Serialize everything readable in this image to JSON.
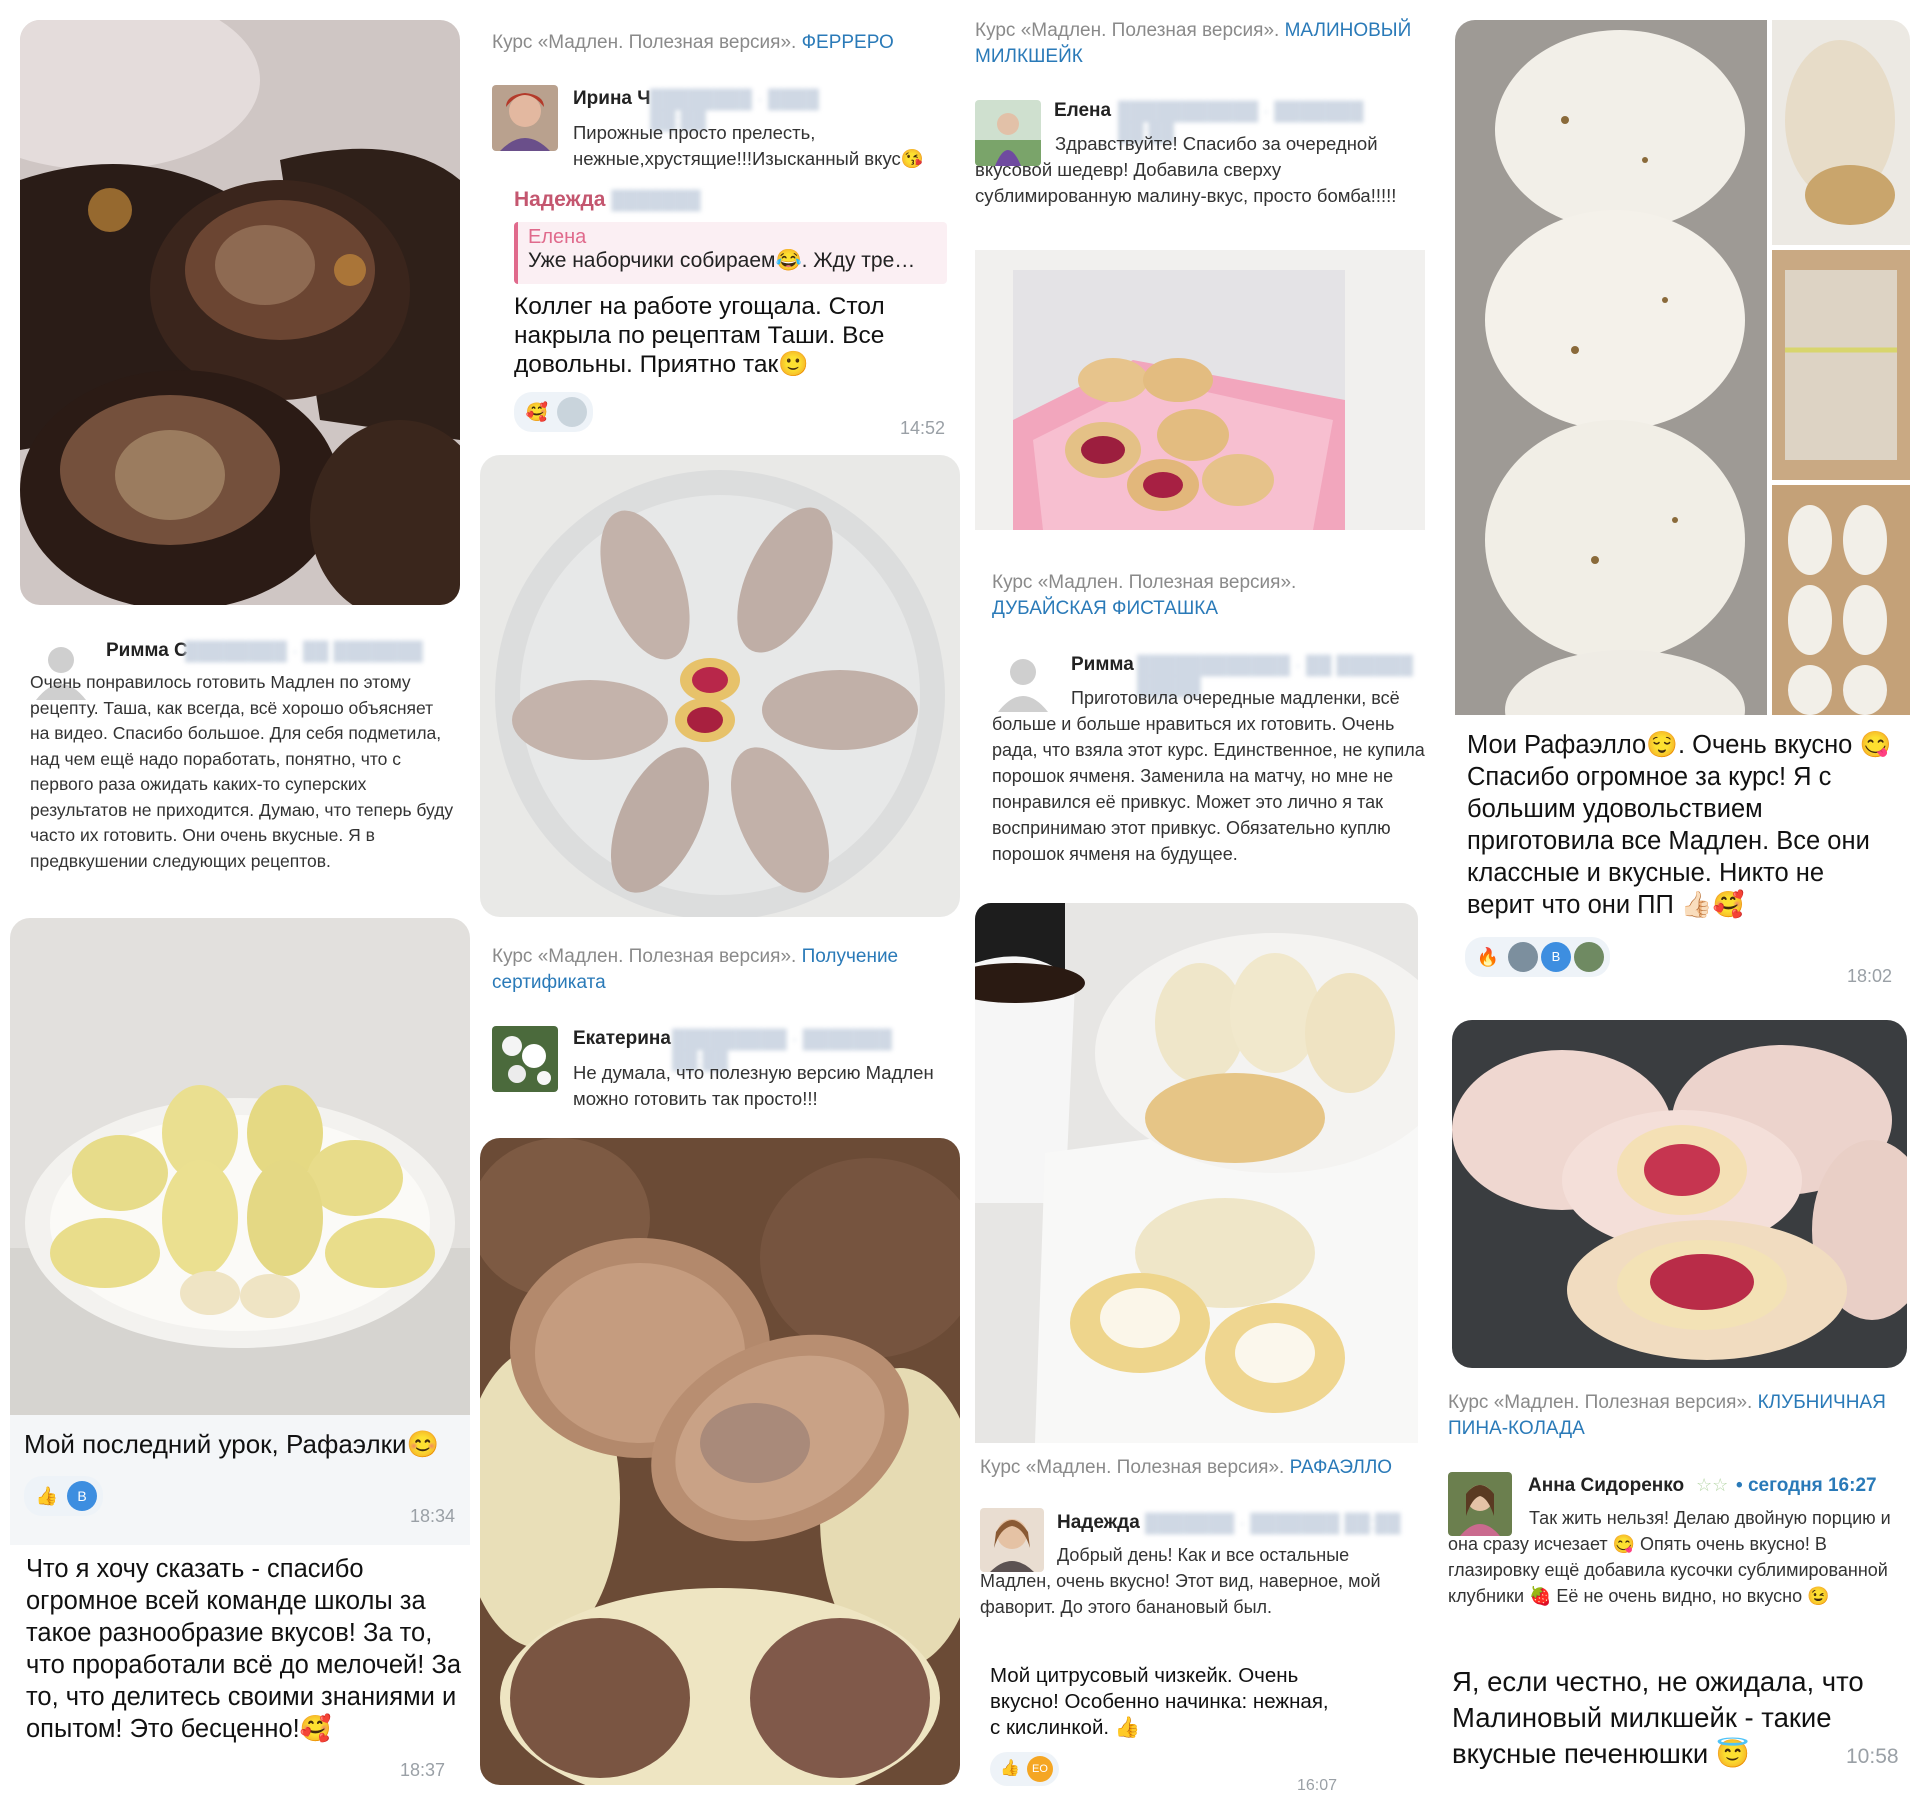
{
  "course_prefix": "Курс «Мадлен. Полезная версия».",
  "reviews": {
    "rimma_s": {
      "author": "Римма С",
      "text": "Очень понравилось готовить Мадлен по этому рецепту. Таша, как всегда, всё хорошо объясняет на видео. Спасибо большое. Для себя подметила, над чем ещё надо поработать, понятно, что с первого раза ожидать каких-то суперских результатов не приходится. Думаю, что теперь буду часто их готовить. Они очень вкусные. Я в предвкушении следующих рецептов."
    },
    "irina": {
      "course_link": "ФЕРРЕРО",
      "author": "Ирина Ч",
      "text": "Пирожные просто прелесть, нежные,хрустящие!!!Изысканный вкус😘"
    },
    "nadezhda_chat": {
      "author": "Надежда",
      "quote_author": "Елена",
      "quote_text": "Уже наборчики собираем😂. Жду тре…",
      "text": "Коллег на работе угощала. Стол накрыла по рецептам Таши. Все довольны. Приятно так🙂",
      "reaction": "🥰",
      "time": "14:52"
    },
    "elena": {
      "course_link": "МАЛИНОВЫЙ МИЛКШЕЙК",
      "author": "Елена",
      "text": "Здравствуйте! Спасибо за очередной вкусовой шедевр! Добавила сверху сублимированную малину-вкус, просто бомба!!!!!"
    },
    "rimma": {
      "course_link": "ДУБАЙСКАЯ ФИСТАШКА",
      "author": "Римма",
      "text": "Приготовила очередные мадленки, всё больше и больше нравиться их готовить. Очень рада, что взяла этот курс. Единственное, не купила порошок ячменя. Заменила на матчу, но мне не понравился её привкус. Может это лично я так воспринимаю этот привкус. Обязательно куплю порошок ячменя на будущее."
    },
    "raffaello_chat": {
      "text": "Мои Рафаэлло😌. Очень вкусно 😋Спасибо огромное за курс! Я с большим удовольствием приготовила все Мадлен. Все они классные и вкусные. Никто не верит что они ПП 👍🏻🥰",
      "reaction": "🔥",
      "badge": "В",
      "time": "18:02"
    },
    "last_lesson_chat": {
      "text": "Мой последний урок, Рафаэлки😊",
      "reaction": "👍",
      "badge": "В",
      "time": "18:34"
    },
    "ekaterina": {
      "course_link": "Получение сертификата",
      "author": "Екатерина",
      "text": "Не думала, что полезную версию Мадлен можно готовить так просто!!!"
    },
    "thanks_chat": {
      "text": "Что я хочу сказать - спасибо огромное всей команде школы за такое разнообразие вкусов! За то, что проработали всё до мелочей! За то, что делитесь своими знаниями и опытом! Это бесценно!🥰",
      "time": "18:37"
    },
    "nadezhda": {
      "course_link": "РАФАЭЛЛО",
      "author": "Надежда",
      "text": "Добрый день! Как и все остальные Мадлен, очень вкусно! Этот вид, наверное, мой фаворит. До этого банановый был."
    },
    "citrus_chat": {
      "text": "Мой цитрусовый чизкейк. Очень вкусно! Особенно начинка: нежная, с кислинкой. 👍",
      "reaction": "👍",
      "badge": "ЕО",
      "time": "16:07"
    },
    "anna": {
      "course_link": "КЛУБНИЧНАЯ ПИНА-КОЛАДА",
      "author": "Анна Сидоренко",
      "date": "сегодня 16:27",
      "text": "Так жить нельзя! Делаю двойную порцию и она сразу исчезает 😋 Опять очень вкусно! В глазировку ещё добавила кусочки сублимированной клубники 🍓 Её не очень видно, но вкусно 😉"
    },
    "milkshake_chat": {
      "text": "Я, если честно, не ожидала, что Малиновый милкшейк - такие вкусные печенюшки 😇",
      "time": "10:58"
    }
  },
  "colors": {
    "link": "#2a7ab8",
    "quote_accent": "#e06a8c",
    "author_pink": "#c4566f"
  }
}
